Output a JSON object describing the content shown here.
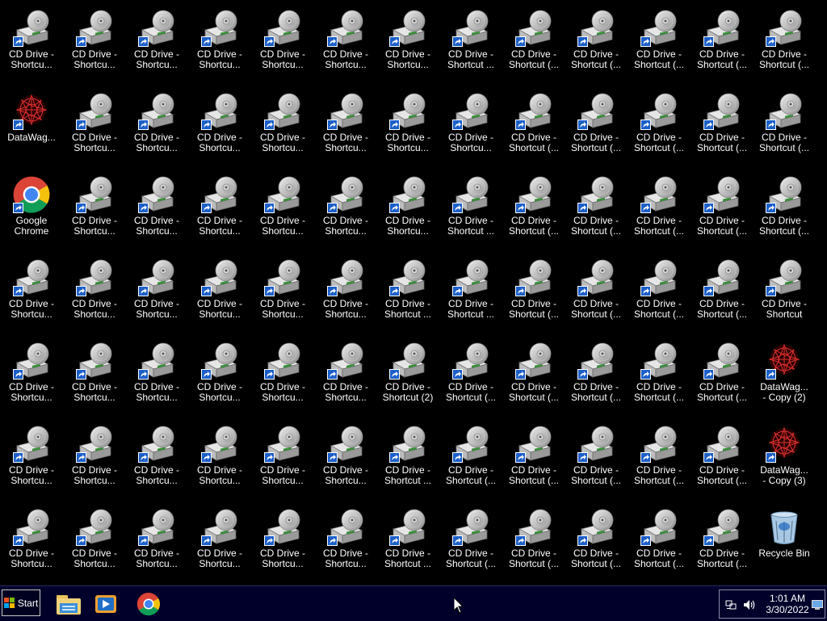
{
  "desktop": {
    "rows": [
      [
        {
          "label": "CD Drive -\nShortcu...",
          "type": "cd"
        },
        {
          "label": "CD Drive -\nShortcu...",
          "type": "cd"
        },
        {
          "label": "CD Drive -\nShortcu...",
          "type": "cd"
        },
        {
          "label": "CD Drive -\nShortcu...",
          "type": "cd"
        },
        {
          "label": "CD Drive -\nShortcu...",
          "type": "cd"
        },
        {
          "label": "CD Drive -\nShortcu...",
          "type": "cd"
        },
        {
          "label": "CD Drive -\nShortcu...",
          "type": "cd"
        },
        {
          "label": "CD Drive -\nShortcut ...",
          "type": "cd"
        },
        {
          "label": "CD Drive -\nShortcut (...",
          "type": "cd"
        },
        {
          "label": "CD Drive -\nShortcut (...",
          "type": "cd"
        },
        {
          "label": "CD Drive -\nShortcut (...",
          "type": "cd"
        },
        {
          "label": "CD Drive -\nShortcut (...",
          "type": "cd"
        },
        {
          "label": "CD Drive -\nShortcut (...",
          "type": "cd"
        }
      ],
      [
        {
          "label": "DataWag...",
          "type": "datawag"
        },
        {
          "label": "CD Drive -\nShortcu...",
          "type": "cd"
        },
        {
          "label": "CD Drive -\nShortcu...",
          "type": "cd"
        },
        {
          "label": "CD Drive -\nShortcu...",
          "type": "cd"
        },
        {
          "label": "CD Drive -\nShortcu...",
          "type": "cd"
        },
        {
          "label": "CD Drive -\nShortcu...",
          "type": "cd"
        },
        {
          "label": "CD Drive -\nShortcu...",
          "type": "cd"
        },
        {
          "label": "CD Drive -\nShortcu...",
          "type": "cd"
        },
        {
          "label": "CD Drive -\nShortcut (...",
          "type": "cd"
        },
        {
          "label": "CD Drive -\nShortcut (...",
          "type": "cd"
        },
        {
          "label": "CD Drive -\nShortcut (...",
          "type": "cd"
        },
        {
          "label": "CD Drive -\nShortcut (...",
          "type": "cd"
        },
        {
          "label": "CD Drive -\nShortcut (...",
          "type": "cd"
        }
      ],
      [
        {
          "label": "Google\nChrome",
          "type": "chrome"
        },
        {
          "label": "CD Drive -\nShortcu...",
          "type": "cd"
        },
        {
          "label": "CD Drive -\nShortcu...",
          "type": "cd"
        },
        {
          "label": "CD Drive -\nShortcu...",
          "type": "cd"
        },
        {
          "label": "CD Drive -\nShortcu...",
          "type": "cd"
        },
        {
          "label": "CD Drive -\nShortcu...",
          "type": "cd"
        },
        {
          "label": "CD Drive -\nShortcu...",
          "type": "cd"
        },
        {
          "label": "CD Drive -\nShortcut ...",
          "type": "cd"
        },
        {
          "label": "CD Drive -\nShortcut (...",
          "type": "cd"
        },
        {
          "label": "CD Drive -\nShortcut (...",
          "type": "cd"
        },
        {
          "label": "CD Drive -\nShortcut (...",
          "type": "cd"
        },
        {
          "label": "CD Drive -\nShortcut (...",
          "type": "cd"
        },
        {
          "label": "CD Drive -\nShortcut (...",
          "type": "cd"
        }
      ],
      [
        {
          "label": "CD Drive -\nShortcu...",
          "type": "cd"
        },
        {
          "label": "CD Drive -\nShortcu...",
          "type": "cd"
        },
        {
          "label": "CD Drive -\nShortcu...",
          "type": "cd"
        },
        {
          "label": "CD Drive -\nShortcu...",
          "type": "cd"
        },
        {
          "label": "CD Drive -\nShortcu...",
          "type": "cd"
        },
        {
          "label": "CD Drive -\nShortcu...",
          "type": "cd"
        },
        {
          "label": "CD Drive -\nShortcut ...",
          "type": "cd"
        },
        {
          "label": "CD Drive -\nShortcut ...",
          "type": "cd"
        },
        {
          "label": "CD Drive -\nShortcut (...",
          "type": "cd"
        },
        {
          "label": "CD Drive -\nShortcut (...",
          "type": "cd"
        },
        {
          "label": "CD Drive -\nShortcut (...",
          "type": "cd"
        },
        {
          "label": "CD Drive -\nShortcut (...",
          "type": "cd"
        },
        {
          "label": "CD Drive -\nShortcut",
          "type": "cd"
        }
      ],
      [
        {
          "label": "CD Drive -\nShortcu...",
          "type": "cd"
        },
        {
          "label": "CD Drive -\nShortcu...",
          "type": "cd"
        },
        {
          "label": "CD Drive -\nShortcu...",
          "type": "cd"
        },
        {
          "label": "CD Drive -\nShortcu...",
          "type": "cd"
        },
        {
          "label": "CD Drive -\nShortcu...",
          "type": "cd"
        },
        {
          "label": "CD Drive -\nShortcu...",
          "type": "cd"
        },
        {
          "label": "CD Drive -\nShortcut (2)",
          "type": "cd"
        },
        {
          "label": "CD Drive -\nShortcut (...",
          "type": "cd"
        },
        {
          "label": "CD Drive -\nShortcut (...",
          "type": "cd"
        },
        {
          "label": "CD Drive -\nShortcut (...",
          "type": "cd"
        },
        {
          "label": "CD Drive -\nShortcut (...",
          "type": "cd"
        },
        {
          "label": "CD Drive -\nShortcut (...",
          "type": "cd"
        },
        {
          "label": "DataWag...\n- Copy (2)",
          "type": "datawag"
        }
      ],
      [
        {
          "label": "CD Drive -\nShortcu...",
          "type": "cd"
        },
        {
          "label": "CD Drive -\nShortcu...",
          "type": "cd"
        },
        {
          "label": "CD Drive -\nShortcu...",
          "type": "cd"
        },
        {
          "label": "CD Drive -\nShortcu...",
          "type": "cd"
        },
        {
          "label": "CD Drive -\nShortcu...",
          "type": "cd"
        },
        {
          "label": "CD Drive -\nShortcu...",
          "type": "cd"
        },
        {
          "label": "CD Drive -\nShortcut ...",
          "type": "cd"
        },
        {
          "label": "CD Drive -\nShortcut (...",
          "type": "cd"
        },
        {
          "label": "CD Drive -\nShortcut (...",
          "type": "cd"
        },
        {
          "label": "CD Drive -\nShortcut (...",
          "type": "cd"
        },
        {
          "label": "CD Drive -\nShortcut (...",
          "type": "cd"
        },
        {
          "label": "CD Drive -\nShortcut (...",
          "type": "cd"
        },
        {
          "label": "DataWag...\n- Copy (3)",
          "type": "datawag"
        }
      ],
      [
        {
          "label": "CD Drive -\nShortcu...",
          "type": "cd"
        },
        {
          "label": "CD Drive -\nShortcu...",
          "type": "cd"
        },
        {
          "label": "CD Drive -\nShortcu...",
          "type": "cd"
        },
        {
          "label": "CD Drive -\nShortcu...",
          "type": "cd"
        },
        {
          "label": "CD Drive -\nShortcu...",
          "type": "cd"
        },
        {
          "label": "CD Drive -\nShortcu...",
          "type": "cd"
        },
        {
          "label": "CD Drive -\nShortcut ...",
          "type": "cd"
        },
        {
          "label": "CD Drive -\nShortcut (...",
          "type": "cd"
        },
        {
          "label": "CD Drive -\nShortcut (...",
          "type": "cd"
        },
        {
          "label": "CD Drive -\nShortcut (...",
          "type": "cd"
        },
        {
          "label": "CD Drive -\nShortcut (...",
          "type": "cd"
        },
        {
          "label": "CD Drive -\nShortcut (...",
          "type": "cd"
        },
        {
          "label": "Recycle Bin",
          "type": "recycle"
        }
      ]
    ]
  },
  "taskbar": {
    "start_label": "Start",
    "pinned": [
      {
        "name": "file-explorer-icon"
      },
      {
        "name": "media-player-icon"
      },
      {
        "name": "chrome-icon"
      }
    ],
    "tray_icons": [
      "network-icon",
      "volume-icon",
      "show-desktop-icon"
    ],
    "clock_time": "1:01 AM",
    "clock_date": "3/30/2022"
  },
  "colors": {
    "desktop_bg": "#000000",
    "taskbar_bg": "#00002a",
    "label_text": "#ffffff"
  }
}
